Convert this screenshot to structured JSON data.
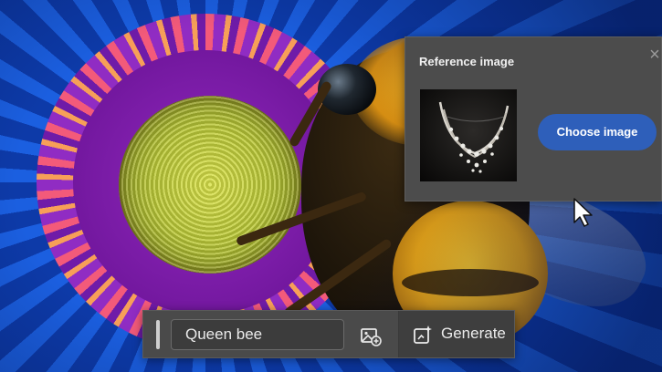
{
  "reference_panel": {
    "title": "Reference image",
    "choose_button_label": "Choose image",
    "close_icon": "×"
  },
  "prompt_bar": {
    "prompt_value": "Queen bee",
    "image_icon": "add-image-icon",
    "generate_label": "Generate",
    "generate_icon": "sparkle-image-icon"
  },
  "colors": {
    "panel_bg": "#4c4c4c",
    "accent_button": "#2e5fba",
    "bar_bg": "#4a4a4a"
  }
}
